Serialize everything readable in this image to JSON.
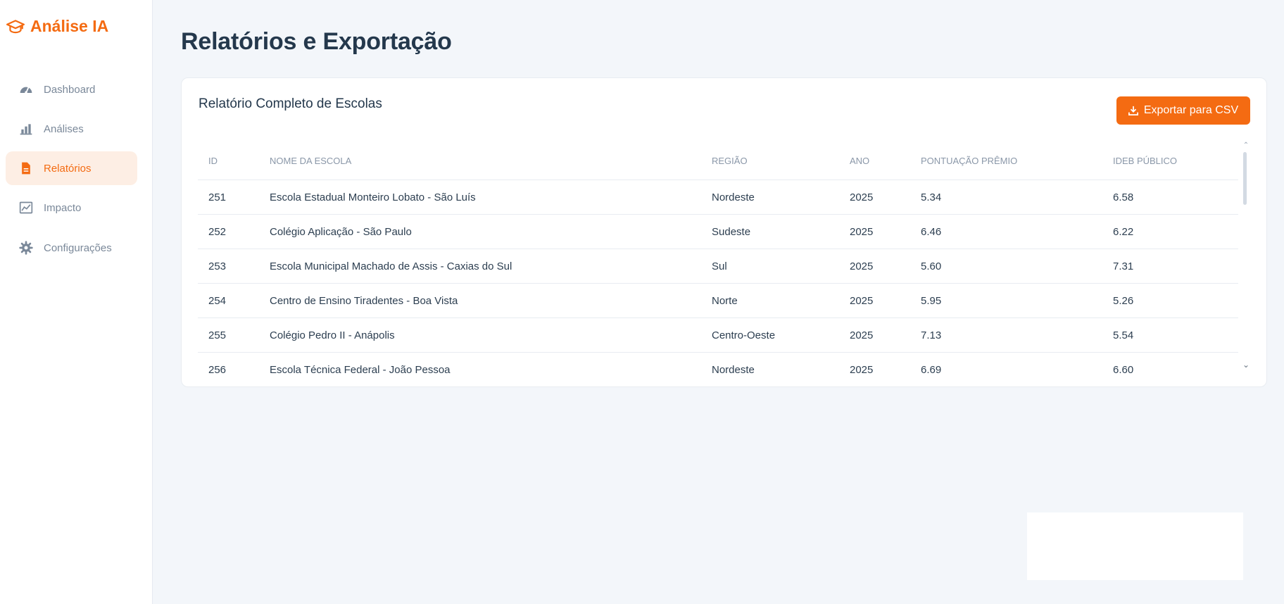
{
  "brand": {
    "name": "Análise IA",
    "icon": "graduation-cap-icon",
    "color": "#f46b12"
  },
  "sidebar": {
    "items": [
      {
        "label": "Dashboard",
        "icon": "gauge-icon",
        "active": false
      },
      {
        "label": "Análises",
        "icon": "bar-chart-icon",
        "active": false
      },
      {
        "label": "Relatórios",
        "icon": "file-report-icon",
        "active": true
      },
      {
        "label": "Impacto",
        "icon": "line-chart-icon",
        "active": false
      },
      {
        "label": "Configurações",
        "icon": "gear-icon",
        "active": false
      }
    ]
  },
  "page": {
    "title": "Relatórios e Exportação"
  },
  "report": {
    "title": "Relatório Completo de Escolas",
    "export_label": "Exportar para CSV",
    "export_icon": "download-icon",
    "columns": [
      "ID",
      "NOME DA ESCOLA",
      "REGIÃO",
      "ANO",
      "PONTUAÇÃO PRÊMIO",
      "IDEB PÚBLICO"
    ],
    "rows": [
      [
        "251",
        "Escola Estadual Monteiro Lobato - São Luís",
        "Nordeste",
        "2025",
        "5.34",
        "6.58"
      ],
      [
        "252",
        "Colégio Aplicação - São Paulo",
        "Sudeste",
        "2025",
        "6.46",
        "6.22"
      ],
      [
        "253",
        "Escola Municipal Machado de Assis - Caxias do Sul",
        "Sul",
        "2025",
        "5.60",
        "7.31"
      ],
      [
        "254",
        "Centro de Ensino Tiradentes - Boa Vista",
        "Norte",
        "2025",
        "5.95",
        "5.26"
      ],
      [
        "255",
        "Colégio Pedro II - Anápolis",
        "Centro-Oeste",
        "2025",
        "7.13",
        "5.54"
      ],
      [
        "256",
        "Escola Técnica Federal - João Pessoa",
        "Nordeste",
        "2025",
        "6.69",
        "6.60"
      ]
    ]
  },
  "scrollbar": {
    "up_glyph": "⌃",
    "down_glyph": "⌄"
  },
  "colors": {
    "accent": "#f46b12",
    "active_bg": "#fdeee4",
    "background": "#f3f6fa"
  }
}
